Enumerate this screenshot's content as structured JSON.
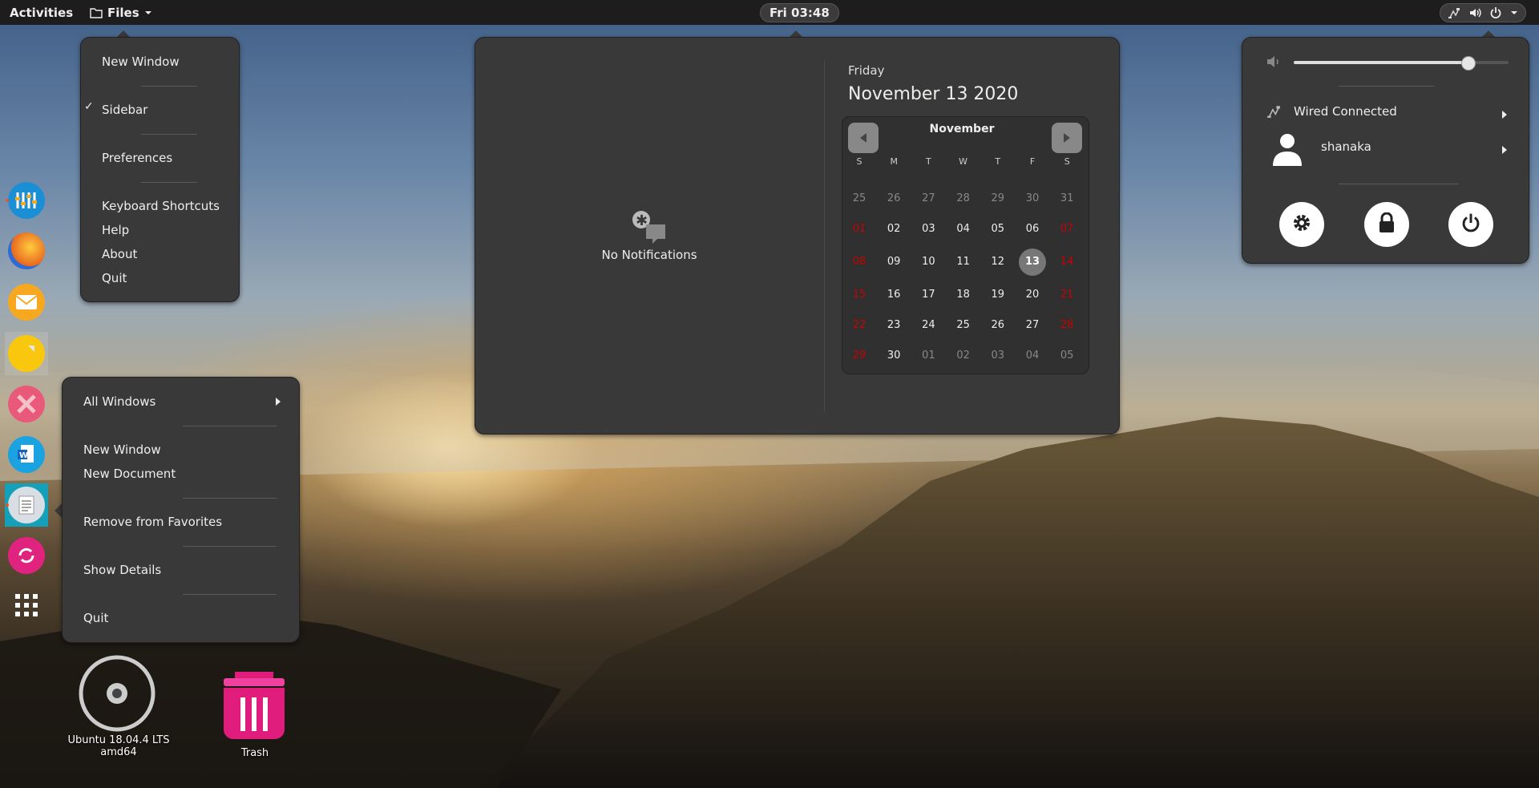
{
  "topbar": {
    "activities": "Activities",
    "app_name": "Files",
    "clock": "Fri 03:48"
  },
  "app_menu": {
    "items": [
      "New Window",
      "Sidebar",
      "Preferences",
      "Keyboard Shortcuts",
      "Help",
      "About",
      "Quit"
    ],
    "sidebar_check": "✓"
  },
  "dock_menu": {
    "items": [
      "All Windows",
      "New Window",
      "New Document",
      "Remove from Favorites",
      "Show Details",
      "Quit"
    ]
  },
  "date_panel": {
    "no_notifications": "No Notifications",
    "weekday": "Friday",
    "full_date": "November 13 2020",
    "month": "November",
    "day_headers": [
      "S",
      "M",
      "T",
      "W",
      "T",
      "F",
      "S"
    ],
    "weeks": [
      [
        "25",
        "26",
        "27",
        "28",
        "29",
        "30",
        "31"
      ],
      [
        "01",
        "02",
        "03",
        "04",
        "05",
        "06",
        "07"
      ],
      [
        "08",
        "09",
        "10",
        "11",
        "12",
        "13",
        "14"
      ],
      [
        "15",
        "16",
        "17",
        "18",
        "19",
        "20",
        "21"
      ],
      [
        "22",
        "23",
        "24",
        "25",
        "26",
        "27",
        "28"
      ],
      [
        "29",
        "30",
        "01",
        "02",
        "03",
        "04",
        "05"
      ]
    ],
    "today": "13"
  },
  "system_menu": {
    "volume_level": 0.81,
    "network": "Wired Connected",
    "user": "shanaka"
  },
  "desktop": {
    "drive_label": "Ubuntu 18.04.4 LTS amd64",
    "trash_label": "Trash"
  },
  "colors": {
    "panel": "#393939",
    "topbar": "#1d1d1d",
    "accent_orange": "#e95420",
    "weekend_red": "#cc0000"
  }
}
